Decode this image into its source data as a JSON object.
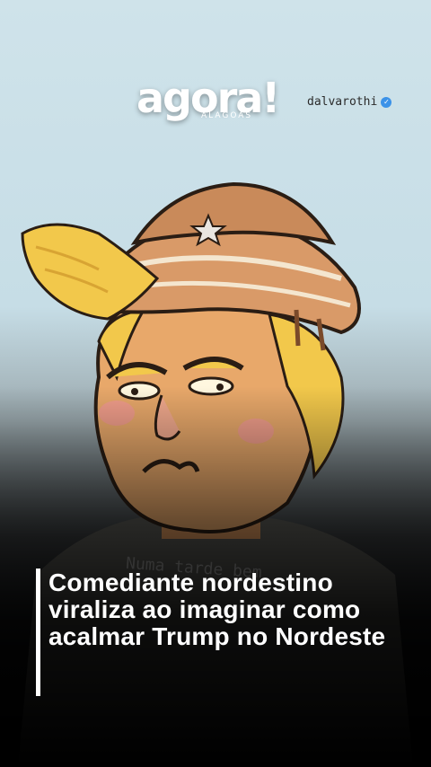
{
  "brand": {
    "logo_text": "agora!",
    "logo_subtext": "ALAGOAS"
  },
  "creator": {
    "handle": "dalvarothi",
    "verified_icon": "verified-check-icon"
  },
  "artwork": {
    "shirt_text": "Numa tarde bem"
  },
  "headline": "Comediante nordestino viraliza ao imaginar como acalmar Trump no Nordeste",
  "colors": {
    "sky": "#cfe3ea",
    "hat": "#c98a5a",
    "hair": "#f2c84b",
    "skin": "#e8a86a",
    "verified": "#3b92e8",
    "text": "#ffffff"
  }
}
